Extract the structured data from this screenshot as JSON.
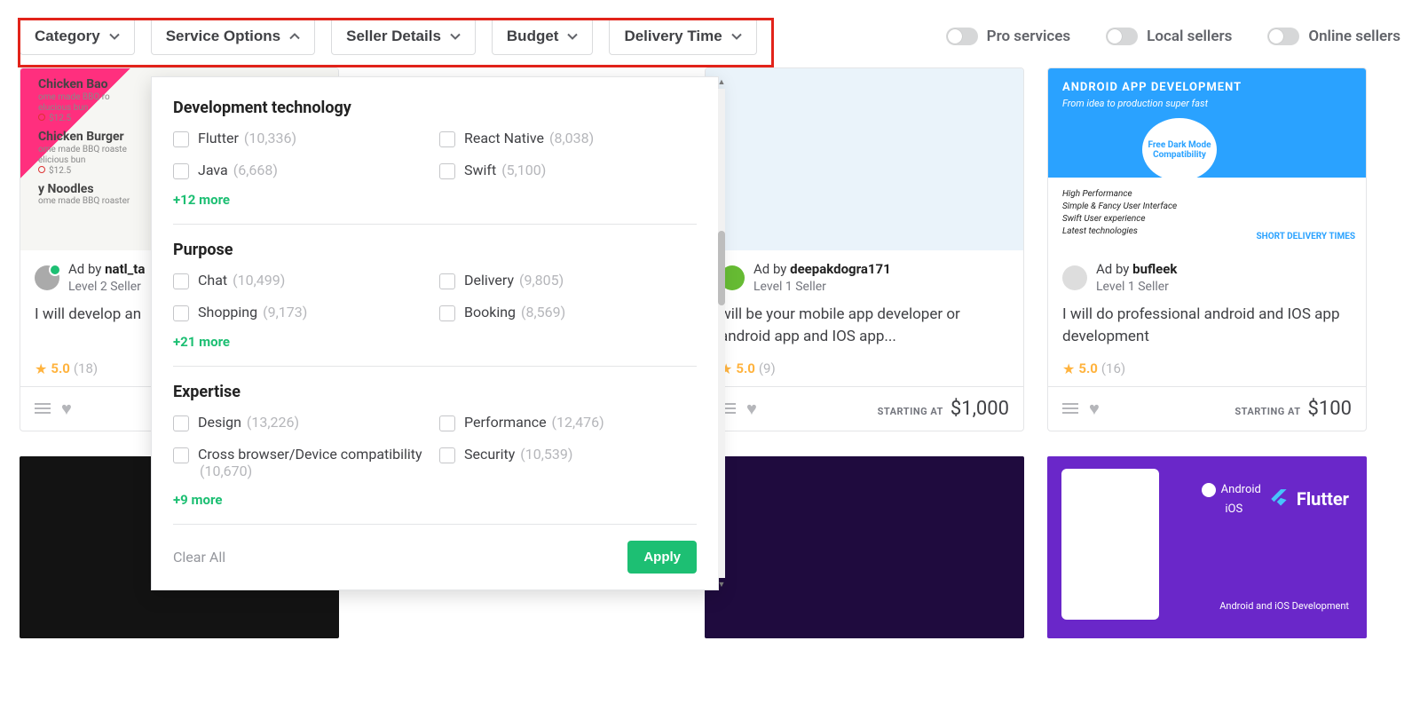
{
  "filters": {
    "category": "Category",
    "service_options": "Service Options",
    "seller_details": "Seller Details",
    "budget": "Budget",
    "delivery_time": "Delivery Time"
  },
  "toggles": {
    "pro": "Pro services",
    "local": "Local sellers",
    "online": "Online sellers"
  },
  "panel": {
    "sections": [
      {
        "title": "Development technology",
        "options": [
          {
            "label": "Flutter",
            "count": "(10,336)"
          },
          {
            "label": "React Native",
            "count": "(8,038)"
          },
          {
            "label": "Java",
            "count": "(6,668)"
          },
          {
            "label": "Swift",
            "count": "(5,100)"
          }
        ],
        "more": "+12 more"
      },
      {
        "title": "Purpose",
        "options": [
          {
            "label": "Chat",
            "count": "(10,499)"
          },
          {
            "label": "Delivery",
            "count": "(9,805)"
          },
          {
            "label": "Shopping",
            "count": "(9,173)"
          },
          {
            "label": "Booking",
            "count": "(8,569)"
          }
        ],
        "more": "+21 more"
      },
      {
        "title": "Expertise",
        "options": [
          {
            "label": "Design",
            "count": "(13,226)"
          },
          {
            "label": "Performance",
            "count": "(12,476)"
          },
          {
            "label": "Cross browser/Device compatibility",
            "count": "(10,670)"
          },
          {
            "label": "Security",
            "count": "(10,539)"
          }
        ],
        "more": "+9 more"
      }
    ],
    "clear": "Clear All",
    "apply": "Apply"
  },
  "cards": [
    {
      "ad_by_prefix": "Ad by ",
      "seller": "natl_ta",
      "level": "Level 2 Seller",
      "title": "I will develop an",
      "rating": "5.0",
      "count": "(18)"
    },
    {
      "ad_by_prefix": "Ad by ",
      "seller": "deepakdogra171",
      "level": "Level 1 Seller",
      "title": "will be your mobile app developer or android app and IOS app...",
      "rating": "5.0",
      "count": "(9)",
      "starting": "STARTING AT",
      "price": "$1,000"
    },
    {
      "ad_by_prefix": "Ad by ",
      "seller": "bufleek",
      "level": "Level 1 Seller",
      "title": "I will do professional android and IOS app development",
      "rating": "5.0",
      "count": "(16)",
      "starting": "STARTING AT",
      "price": "$100"
    }
  ],
  "card4_img": {
    "header": "ANDROID APP DEVELOPMENT",
    "sub": "From idea to production super fast",
    "circle": "Free Dark Mode Compatibility",
    "b1": "High Performance",
    "b2": "Simple & Fancy User Interface",
    "b3": "Swift User experience",
    "b4": "Latest technologies",
    "short": "SHORT DELIVERY TIMES"
  },
  "card1_img": {
    "l1": "Chicken Bao",
    "s1": "ome made BBQ ro",
    "s1b": "elucious bun",
    "p1": "$12.5",
    "l2": "Chicken Burger",
    "s2": "ome made BBQ roaste",
    "s2b": "elicious bun",
    "p2": "$12.5",
    "l3": "y Noodles",
    "s3": "ome made BBQ roaster"
  },
  "row2d": {
    "android": "Android",
    "ios": "iOS",
    "flutter": "Flutter",
    "tag": "Android and iOS Development"
  }
}
